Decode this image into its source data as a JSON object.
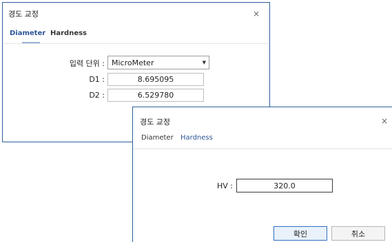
{
  "dialog1": {
    "title": "경도 교정",
    "close_glyph": "×",
    "tabs": [
      {
        "label": "Diameter",
        "active": true
      },
      {
        "label": "Hardness",
        "active": false
      }
    ],
    "unit_label": "입력 단위 :",
    "unit_value": "MicroMeter",
    "d1_label": "D1 :",
    "d1_value": "8.695095",
    "d2_label": "D2 :",
    "d2_value": "6.529780"
  },
  "dialog2": {
    "title": "경도 교정",
    "close_glyph": "×",
    "tabs": [
      {
        "label": "Diameter",
        "active": false
      },
      {
        "label": "Hardness",
        "active": true
      }
    ],
    "hv_label": "HV :",
    "hv_value": "320.0",
    "ok_label": "확인",
    "cancel_label": "취소"
  },
  "colors": {
    "active_tab": "#2d5597",
    "inactive_tab": "#333333",
    "border": "#2e5f9e"
  }
}
